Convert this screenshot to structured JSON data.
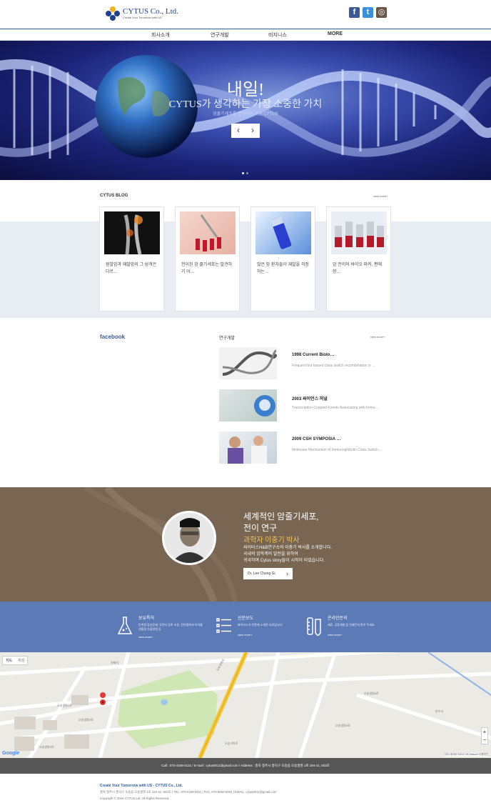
{
  "header": {
    "logo_name": "CYTUS Co., Ltd.",
    "logo_tagline": "Create Your Tomorrow with US",
    "social": [
      {
        "name": "facebook",
        "glyph": "f",
        "color": "#3b5998"
      },
      {
        "name": "twitter",
        "glyph": "t",
        "color": "#3b8fd8"
      },
      {
        "name": "instagram",
        "glyph": "◎",
        "color": "#6b5547"
      }
    ]
  },
  "nav": {
    "items": [
      "회사소개",
      "연구개발",
      "비지니스",
      "MORE"
    ]
  },
  "hero": {
    "title": "내일!",
    "subtitle": "CYTUS가 생각하는 가장 소중한 가치",
    "caption": "암줄기세포를 연구하는 기업 CYTUS",
    "prev": "‹",
    "next": "›"
  },
  "blog": {
    "title": "CYTUS BLOG",
    "view_more": "view more+",
    "cards": [
      {
        "text": "원발암과 재발암의 그 성격은 다르…"
      },
      {
        "text": "전이된 암 줄기세포는 발견하기 어…"
      },
      {
        "text": "많은 암 환자들이 재발을 걱정하는…"
      },
      {
        "text": "암 전이의 바이오 마커, 편에향…"
      }
    ]
  },
  "facebook_label": "facebook",
  "research": {
    "title": "연구개발",
    "view_more": "view more+",
    "items": [
      {
        "title": "1998 Current Biolo…",
        "desc": "Frequent but biased class switch recombination in …"
      },
      {
        "title": "2003 싸이언스 저널",
        "desc": "Transcription-Coupled Events Associating with Immu…"
      },
      {
        "title": "2009 CSH SYMPOSIA …",
        "desc": "Molecular Mechanism of Immunoglobulin Class Switch…"
      }
    ]
  },
  "profile": {
    "heading_line1": "세계적인 암줄기세포,",
    "heading_line2": "전이 연구",
    "subheading": "과학자 이충기 박사",
    "body_line1": "싸이터스H&B연구소의 이충기 박사를 소개합니다.",
    "body_line2": "국내의 암학계의 발전을 위하여",
    "body_line3": "귀국하며 Cytus story들이 시작이 되었습니다.",
    "button": "Dr. Lee Chung Gi",
    "button_arrow": "›"
  },
  "services": [
    {
      "title": "보유특허",
      "desc": "단백질 합성문제, 유전자 등록 조절, 전연결에서 미치활성물질 추출방법 등",
      "more": "view more+"
    },
    {
      "title": "신문보도",
      "desc": "싸이터스가 언론에 소개된 자료입니다.",
      "more": "view more+"
    },
    {
      "title": "온라인문의",
      "desc": "제휴, 공동개발 등 언제든지 편히 주세요.",
      "more": "view more+"
    }
  ],
  "map": {
    "view_buttons": [
      "지도",
      "위성"
    ],
    "roads": [
      "오송생명로",
      "오송생명1로",
      "오송생명2로",
      "오송생명3로",
      "오송가락로",
      "오송생명4로",
      "오송생명6로",
      "연제리",
      "만수리"
    ],
    "google_label": "Google",
    "copyright": "지도 데이터 ©2017 SK telecom  이용약관"
  },
  "contact_bar": "Call : 070-4348-0121   /   E-mail : cytus0011@gmail.com   /   Address : 충북 청주시 흥덕구 오송읍 오송생명 1로 194-41, 503호",
  "footer": {
    "line1": "Create Your Tomorrow with US - CYTUS Co., Ltd.",
    "line2": "충북 청주시 흥덕구 오송읍 오송생명 1로 194-41, 503호  |  TEL. 070-4348-0011  |  FAX. 070-8650-0004  |  EMAIL. cytus0011@gmail.com",
    "line3": "Copyright © 2016 CYTUS.Ltd. All Rights Reserved."
  },
  "colors": {
    "brand_blue": "#2f5d9e",
    "profile_brown": "#786552",
    "services_blue": "#5b7ab6",
    "accent_gold": "#f0c35a"
  }
}
